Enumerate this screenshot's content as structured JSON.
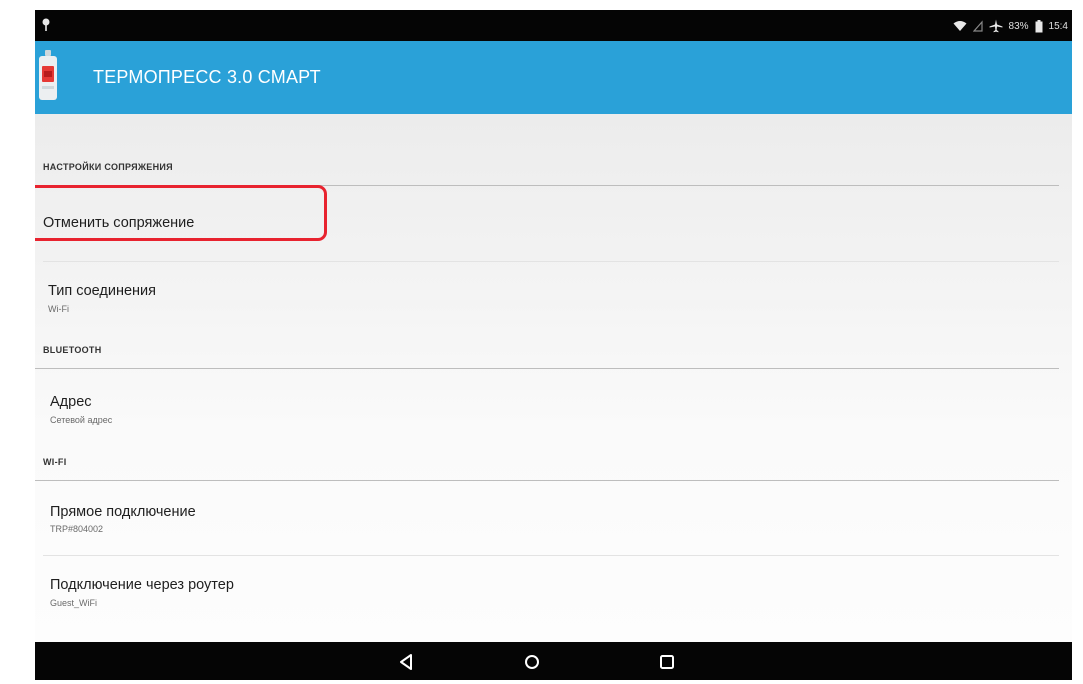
{
  "statusbar": {
    "battery_text": "83%",
    "time": "15:4",
    "icons": [
      "notification-icon",
      "wifi-icon",
      "signal-icon",
      "airplane-icon",
      "battery-icon"
    ]
  },
  "appbar": {
    "title": "ТЕРМОПРЕСС 3.0 СМАРТ",
    "app_icon": "thermopress-device-icon",
    "color": "#2aa1d8"
  },
  "sections": {
    "pairing": {
      "header": "НАСТРОЙКИ СОПРЯЖЕНИЯ",
      "items": [
        {
          "title": "Отменить сопряжение"
        },
        {
          "title": "Тип соединения",
          "subtitle": "Wi-Fi"
        }
      ]
    },
    "bluetooth": {
      "header": "BLUETOOTH",
      "items": [
        {
          "title": "Адрес",
          "subtitle": "Сетевой адрес"
        }
      ]
    },
    "wifi": {
      "header": "WI-FI",
      "items": [
        {
          "title": "Прямое подключение",
          "subtitle": "TRP#804002"
        },
        {
          "title": "Подключение через роутер",
          "subtitle": "Guest_WiFi"
        }
      ]
    }
  },
  "highlight_color": "#e8232f",
  "navbar": {
    "buttons": [
      "back-icon",
      "home-icon",
      "recents-icon"
    ]
  }
}
